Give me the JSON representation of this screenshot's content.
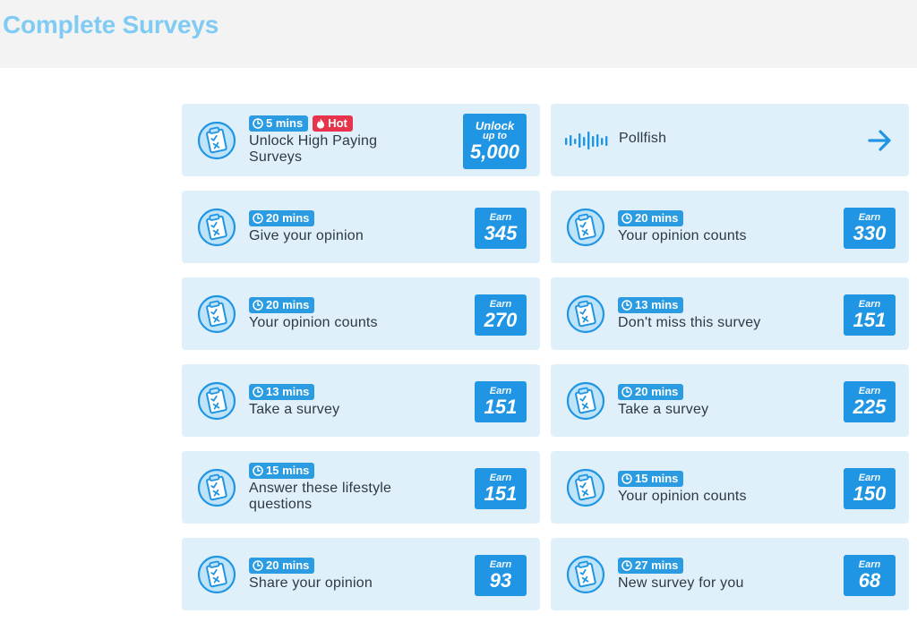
{
  "header": {
    "title": "Complete Surveys"
  },
  "featured": {
    "time": "5 mins",
    "hot": "Hot",
    "title": "Unlock High Paying Surveys",
    "reward_line1": "Unlock",
    "reward_line2": "up to",
    "reward_value": "5,000"
  },
  "provider": {
    "name": "Pollfish",
    "icon": "pollfish-wave-icon"
  },
  "earn_label": "Earn",
  "surveys": [
    {
      "time": "20 mins",
      "title": "Give your opinion",
      "reward": "345"
    },
    {
      "time": "20 mins",
      "title": "Your opinion counts",
      "reward": "330"
    },
    {
      "time": "20 mins",
      "title": "Your opinion counts",
      "reward": "270"
    },
    {
      "time": "13 mins",
      "title": "Don't miss this survey",
      "reward": "151"
    },
    {
      "time": "13 mins",
      "title": "Take a survey",
      "reward": "151"
    },
    {
      "time": "20 mins",
      "title": "Take a survey",
      "reward": "225"
    },
    {
      "time": "15 mins",
      "title": "Answer these lifestyle questions",
      "reward": "151"
    },
    {
      "time": "15 mins",
      "title": "Your opinion counts",
      "reward": "150"
    },
    {
      "time": "20 mins",
      "title": "Share your opinion",
      "reward": "93"
    },
    {
      "time": "27 mins",
      "title": "New survey for you",
      "reward": "68"
    }
  ],
  "colors": {
    "accent": "#1f95e3",
    "card": "#dff0fb",
    "hot": "#e8334c",
    "title": "#7fcbf4"
  }
}
